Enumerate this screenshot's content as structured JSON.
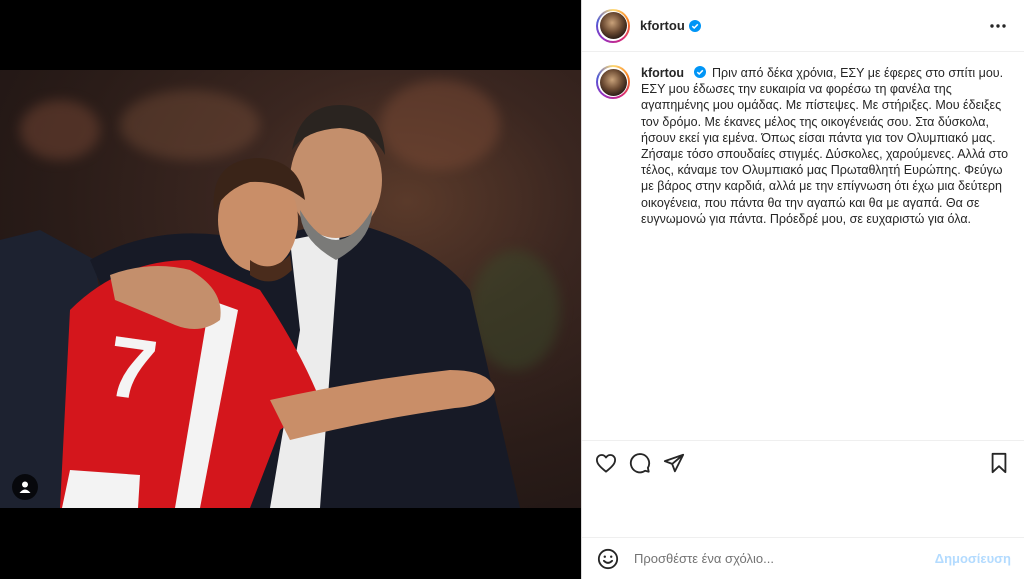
{
  "post": {
    "username": "kfortou",
    "verified": true,
    "caption": "Πριν από δέκα χρόνια, ΕΣΥ με έφερες στο σπίτι μου. ΕΣΥ μου έδωσες την ευκαιρία να φορέσω τη φανέλα της αγαπημένης μου ομάδας. Με πίστεψες. Με στήριξες. Μου έδειξες τον δρόμο. Με έκανες μέλος της οικογένειάς σου. Στα δύσκολα, ήσουν εκεί για εμένα. Όπως είσαι πάντα για τον Ολυμπιακό μας. Ζήσαμε τόσο σπουδαίες στιγμές. Δύσκολες, χαρούμενες. Αλλά στο τέλος, κάναμε τον Ολυμπιακό μας Πρωταθλητή Ευρώπης. Φεύγω με βάρος στην καρδιά, αλλά με την επίγνωση ότι έχω μια δεύτερη οικογένεια, που πάντα θα την αγαπώ και θα με αγαπά. Θα σε ευγνωμονώ για πάντα. Πρόεδρέ μου, σε ευχαριστώ για όλα."
  },
  "media": {
    "jersey_number": "7"
  },
  "icons": {
    "more": "more-horizontal-icon",
    "like": "heart-icon",
    "comment": "comment-icon",
    "share": "share-icon",
    "save": "bookmark-icon",
    "emoji": "emoji-icon",
    "user_tag": "user-tag-icon",
    "verified": "verified-badge-icon"
  },
  "comment": {
    "placeholder": "Προσθέστε ένα σχόλιο...",
    "post_label": "Δημοσίευση"
  },
  "colors": {
    "verified": "#0095f6",
    "post_button_disabled": "#b3dbff",
    "jersey_red": "#d4161c"
  }
}
